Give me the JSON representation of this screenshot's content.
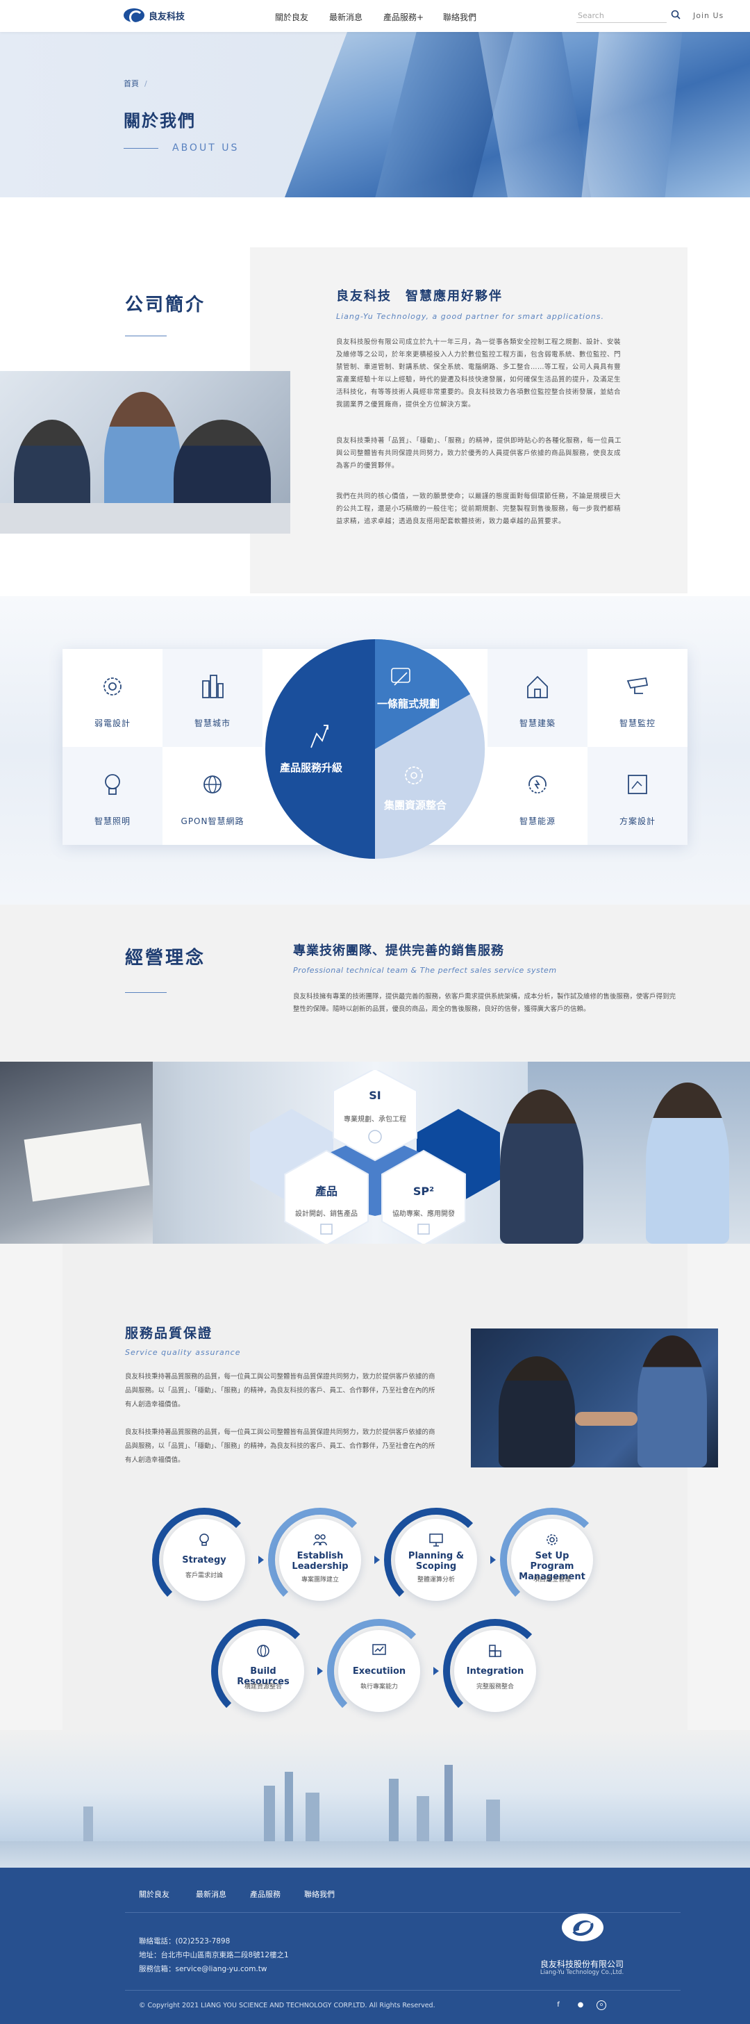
{
  "header": {
    "brand": "良友科技",
    "nav": [
      "關於良友",
      "最新消息",
      "產品服務+",
      "聯絡我們"
    ],
    "search_placeholder": "Search",
    "join": "Join Us"
  },
  "hero": {
    "breadcrumb": "首頁",
    "breadcrumb_sep": "/",
    "title": "關於我們",
    "subtitle": "ABOUT US"
  },
  "intro": {
    "heading": "公司簡介",
    "title": "良友科技　智慧應用好夥伴",
    "subtitle": "Liang-Yu Technology,  a good partner for smart applications.",
    "paragraphs": [
      "良友科技股份有限公司成立於九十一年三月，為一從事各類安全控制工程之規劃、設計、安裝及維修等之公司，於年來更積極投入人力於數位監控工程方面，包含弱電系統、數位監控、門禁管制、車道管制、對講系統、保全系統、電腦網路、多工整合……等工程，公司人員具有豐富產業經驗十年以上經驗，時代的變遷及科技快速發展，如何確保生活品質的提升，及滿足生活科技化，有等等技術人員經非常重要的。良友科技致力各項數位監控整合技術發展，並結合我國業界之優質廠商，提供全方位解決方案。",
      "良友科技秉持著「品質」、「穩動」、「服務」的精神，提供即時貼心的各種化服務，每一位員工與公司整體皆有共同保證共同努力，致力於優秀的人員提供客戶依據的商品與服務，使良友成為客戶的優質夥伴。",
      "我們在共同的核心價值，一致的願景使命；以嚴謹的態度面對每個環節任務，不論是規模巨大的公共工程，還是小巧精緻的一般住宅；從前期規劃、完整製程到售後服務，每一步我們都精益求精，追求卓越；透過良友搭用配套軟體技術，致力最卓越的品質要求。"
    ]
  },
  "services": {
    "cells": [
      {
        "label": "弱電設計",
        "icon": "gear-circuit-icon"
      },
      {
        "label": "智慧城市",
        "icon": "city-buildings-icon"
      },
      {
        "label": "智慧建築",
        "icon": "smart-house-icon"
      },
      {
        "label": "智慧監控",
        "icon": "cctv-camera-icon"
      },
      {
        "label": "智慧照明",
        "icon": "light-bulb-icon"
      },
      {
        "label": "GPON智慧網路",
        "icon": "globe-network-icon"
      },
      {
        "label": "智慧能源",
        "icon": "energy-cycle-icon"
      },
      {
        "label": "方案設計",
        "icon": "blueprint-icon"
      }
    ],
    "pie": [
      {
        "label": "一條龍式規劃",
        "color": "#3c7ac4"
      },
      {
        "label": "產品服務升級",
        "color": "#1a4f9c"
      },
      {
        "label": "集團資源整合",
        "color": "#c7d6ec"
      }
    ]
  },
  "philosophy": {
    "heading": "經營理念",
    "title": "專業技術團隊、提供完善的銷售服務",
    "subtitle": "Professional technical team & The perfect sales service system",
    "text": "良友科技擁有專業的技術團隊，提供最完善的服務，依客戶需求提供系統架構，成本分析，製作試及維修的售後服務，使客戶得到完整性的保障。隨時以創新的品質，優良的商品，周全的售後服務，良好的信譽，獲得廣大客戶的信賴。"
  },
  "hexes": [
    {
      "title": "SI",
      "text": "專業規劃、承包工程"
    },
    {
      "title": "產品",
      "text": "設計開創、銷售產品"
    },
    {
      "title": "SP²",
      "text": "協助專案、應用開發"
    }
  ],
  "quality": {
    "heading": "服務品質保證",
    "subtitle": "Service quality assurance",
    "paragraphs": [
      "良友科技秉持著品質服務的品質，每一位員工與公司整體皆有品質保證共同努力，致力於提供客戶依據的商品與服務。以「品質」、「穩動」、「服務」的精神，為良友科技的客戶、員工、合作夥伴，乃至社會在內的所有人創造幸福價值。",
      "良友科技秉持著品質服務的品質，每一位員工與公司整體皆有品質保證共同努力，致力於提供客戶依據的商品與服務，以「品質」、「穩動」、「服務」的精神，為良友科技的客戶、員工、合作夥伴，乃至社會在內的所有人創造幸福價值。"
    ],
    "steps": [
      {
        "en": "Strategy",
        "zh": "客戶需求討論",
        "icon": "lightbulb-icon"
      },
      {
        "en": "Establish Leadership",
        "zh": "專案團隊建立",
        "icon": "team-icon"
      },
      {
        "en": "Planning & Scoping",
        "zh": "整體運算分析",
        "icon": "presentation-icon"
      },
      {
        "en": "Set Up Program Management",
        "zh": "項目建立管理",
        "icon": "gear-icon"
      },
      {
        "en": "Build Resources",
        "zh": "構建資源整合",
        "icon": "globe-icon"
      },
      {
        "en": "Executiion",
        "zh": "執行專案能力",
        "icon": "chart-board-icon"
      },
      {
        "en": "Integration",
        "zh": "完整服務整合",
        "icon": "puzzle-icon"
      }
    ]
  },
  "footer": {
    "nav": [
      "關於良友",
      "最新消息",
      "產品服務",
      "聯絡我們"
    ],
    "phone": "聯絡電話：(02)2523-7898",
    "address": "地址：台北市中山區南京東路二段8號12樓之1",
    "email": "服務信箱：service@liang-yu.com.tw",
    "company": "良友科技股份有限公司",
    "company_en": "Liang-Yu Technology Co.,Ltd.",
    "copyright": "© Copyright 2021 LIANG YOU SCIENCE AND TECHNOLOGY CORP.LTD. All Rights Reserved."
  },
  "colors": {
    "brand": "#1e3d72",
    "accent": "#5b83bf",
    "footer": "#27508f"
  }
}
